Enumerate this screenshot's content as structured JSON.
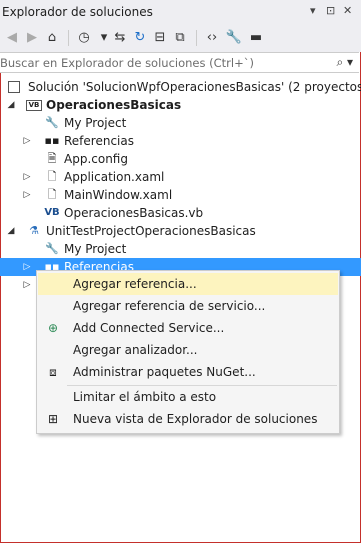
{
  "window": {
    "title": "Explorador de soluciones"
  },
  "title_buttons": [
    "▾",
    "⊡",
    "✕"
  ],
  "search": {
    "placeholder": "Buscar en Explorador de soluciones (Ctrl+`)"
  },
  "tree": {
    "solution": "Solución 'SolucionWpfOperacionesBasicas'  (2 proyectos)",
    "project1": "OperacionesBasicas",
    "p1_items": [
      "My Project",
      "Referencias",
      "App.config",
      "Application.xaml",
      "MainWindow.xaml",
      "OperacionesBasicas.vb"
    ],
    "project2": "UnitTestProjectOperacionesBasicas",
    "p2_items": [
      "My Project",
      "Referencias"
    ]
  },
  "context_menu": {
    "items": [
      "Agregar referencia...",
      "Agregar referencia de servicio...",
      "Add Connected Service...",
      "Agregar analizador...",
      "Administrar paquetes NuGet...",
      "Limitar el ámbito a esto",
      "Nueva vista de Explorador de soluciones"
    ],
    "highlighted_index": 0
  }
}
